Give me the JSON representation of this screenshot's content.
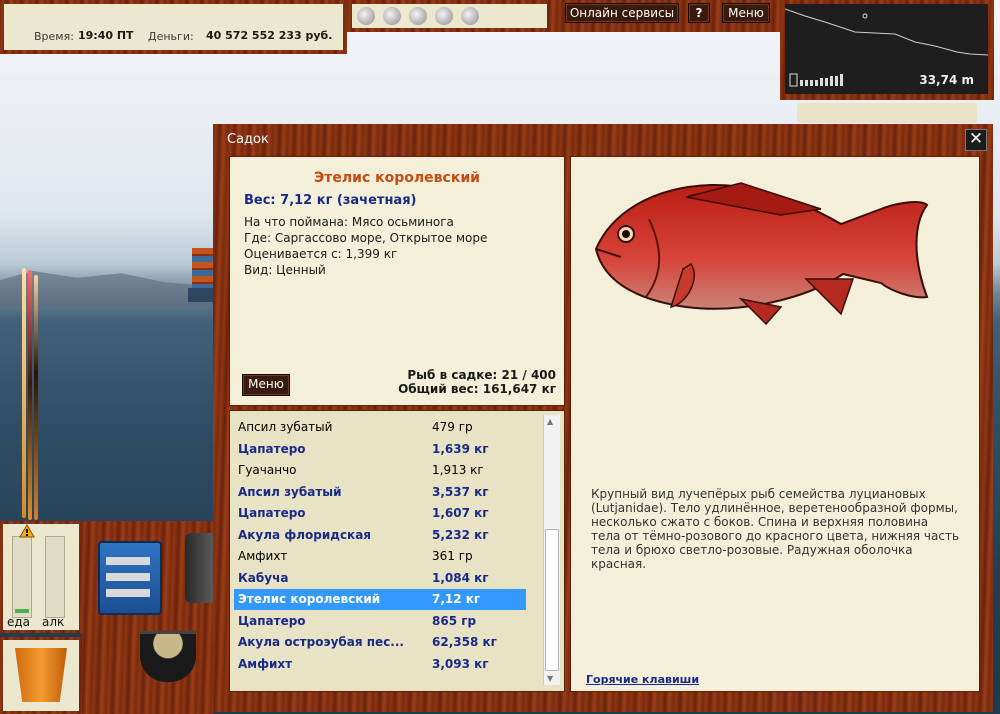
{
  "status": {
    "time_label": "Время:",
    "time_value": "19:40 ПТ",
    "money_label": "Деньги:",
    "money_value": "40 572 552 233 руб."
  },
  "topbar": {
    "online_services": "Онлайн сервисы",
    "help": "?",
    "menu": "Меню"
  },
  "depth_map": {
    "depth": "33,74 m"
  },
  "window": {
    "title": "Садок",
    "close": "✕"
  },
  "fish": {
    "name": "Этелис королевский",
    "weight": "Вес: 7,12 кг (зачетная)",
    "caught_on": "На что поймана: Мясо осьминога",
    "where": "Где: Саргассово море, Открытое море",
    "rated_from": "Оценивается с: 1,399 кг",
    "kind": "Вид: Ценный",
    "description": "Крупный вид лучепёрых рыб семейства луциановых (Lutjanidae). Тело удлинённое, веретенообразной формы, несколько сжато с боков. Спина и верхняя половина тела от тёмно-розового до красного цвета, нижняя часть тела и брюхо светло-розовые. Радужная оболочка красная."
  },
  "keepnet": {
    "menu_button": "Меню",
    "fish_count": "Рыб в садке: 21 / 400",
    "total_weight": "Общий вес: 161,647 кг"
  },
  "list": [
    {
      "name": "Апсил зубатый",
      "weight": "479 гр",
      "bold": false
    },
    {
      "name": "Цапатеро",
      "weight": "1,639 кг",
      "bold": true
    },
    {
      "name": "Гуачанчо",
      "weight": "1,913 кг",
      "bold": false
    },
    {
      "name": "Апсил зубатый",
      "weight": "3,537 кг",
      "bold": true
    },
    {
      "name": "Цапатеро",
      "weight": "1,607 кг",
      "bold": true
    },
    {
      "name": "Акула флоридская",
      "weight": "5,232 кг",
      "bold": true
    },
    {
      "name": "Амфихт",
      "weight": "361 гр",
      "bold": false
    },
    {
      "name": "Кабуча",
      "weight": "1,084 кг",
      "bold": true
    },
    {
      "name": "Этелис королевский",
      "weight": "7,12 кг",
      "bold": true,
      "selected": true
    },
    {
      "name": "Цапатеро",
      "weight": "865 гр",
      "bold": true
    },
    {
      "name": "Акула остроэубая пес...",
      "weight": "62,358 кг",
      "bold": true
    },
    {
      "name": "Амфихт",
      "weight": "3,093 кг",
      "bold": true
    }
  ],
  "links": {
    "hotkeys": "Горячие клавиши"
  },
  "gauges": {
    "food_label": "еда",
    "alc_label": "алк",
    "food_level": 0.05,
    "alc_level": 0.0
  }
}
